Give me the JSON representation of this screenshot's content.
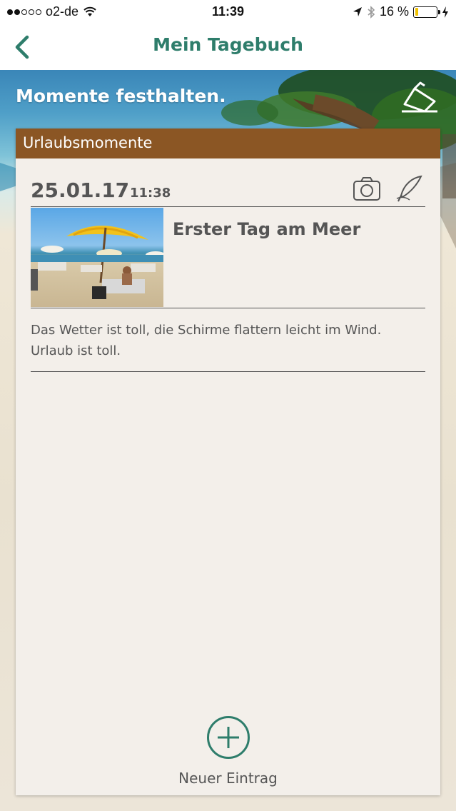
{
  "status_bar": {
    "carrier": "o2-de",
    "time": "11:39",
    "battery_text": "16 %",
    "battery_level": 0.16
  },
  "nav": {
    "title": "Mein Tagebuch"
  },
  "hero": {
    "title": "Momente festhalten."
  },
  "card": {
    "header": "Urlaubsmomente",
    "entry": {
      "date": "25.01.17",
      "time": "11:38",
      "title": "Erster Tag am Meer",
      "text_line1": "Das Wetter ist toll, die Schirme flattern leicht im Wind.",
      "text_line2": "Urlaub ist toll."
    },
    "new_entry_label": "Neuer Eintrag"
  },
  "colors": {
    "accent": "#2e7d6b",
    "header_brown": "#8b5624",
    "text_gray": "#555555",
    "card_bg": "#f3efea"
  },
  "icons": [
    "back-chevron-icon",
    "edit-note-icon",
    "camera-icon",
    "quill-icon",
    "plus-circle-icon"
  ]
}
